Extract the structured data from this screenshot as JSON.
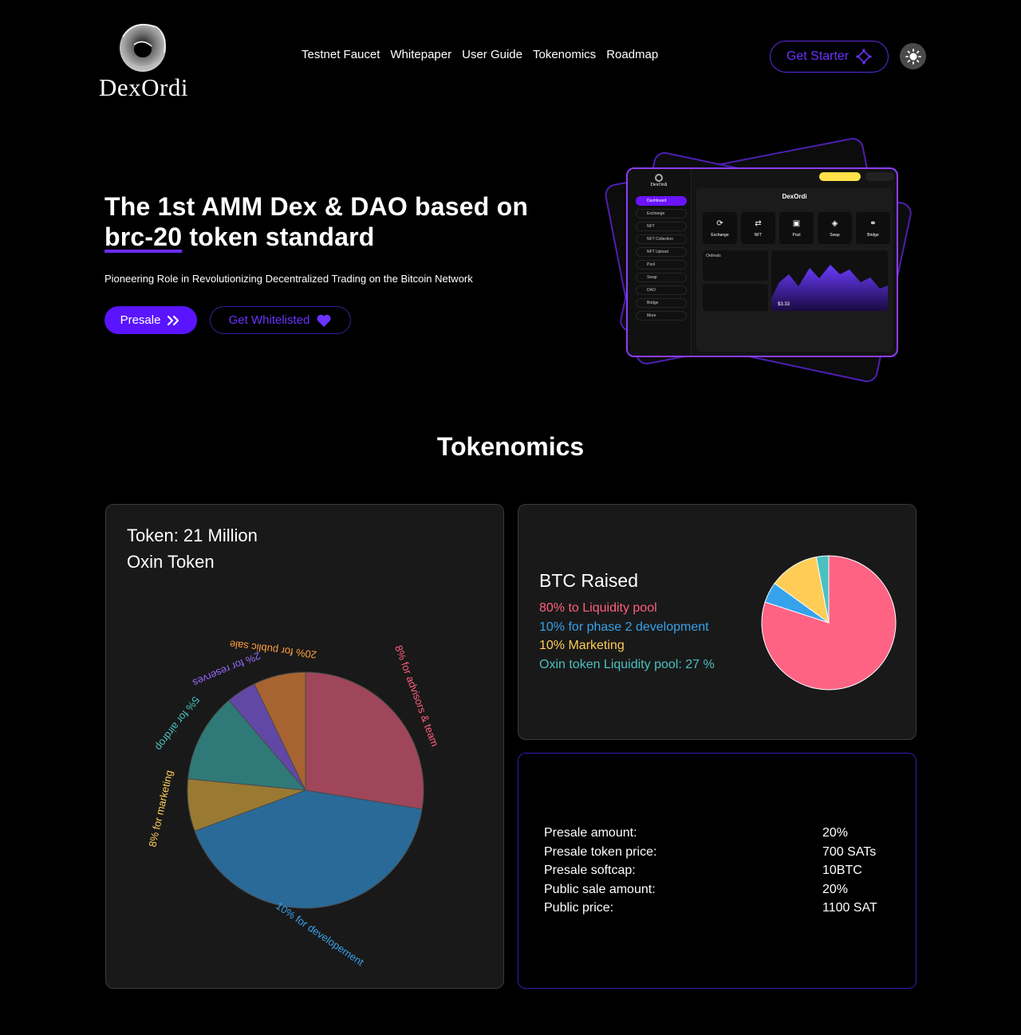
{
  "brand": {
    "name": "DexOrdi"
  },
  "nav": {
    "items": [
      "Testnet Faucet",
      "Whitepaper",
      "User Guide",
      "Tokenomics",
      "Roadmap"
    ],
    "starter_label": "Get Starter"
  },
  "hero": {
    "title_line1": "The 1st AMM Dex & DAO based on",
    "title_highlight": "brc-20",
    "title_rest": " token standard",
    "subtitle": "Pioneering Role in Revolutionizing Decentralized Trading on the Bitcoin Network",
    "presale_label": "Presale",
    "whitelist_label": "Get Whitelisted"
  },
  "mockup": {
    "brand": "DexOrdi",
    "menu": [
      "Dashboard",
      "Exchange",
      "NFT",
      "NFT Collection",
      "NFT Upload",
      "Pool",
      "Swap",
      "DAO",
      "Bridge",
      "More"
    ],
    "title": "DexOrdi",
    "tiles": [
      "Exchange",
      "NFT",
      "Pool",
      "Swap",
      "Bridge"
    ],
    "card_title": "Ordinals",
    "price": "$3.33"
  },
  "tokenomics": {
    "title": "Tokenomics",
    "token_card": {
      "line1": "Token: 21 Million",
      "line2": "Oxin Token"
    },
    "btc_card": {
      "title": "BTC Raised",
      "lines": [
        {
          "text": "80% to Liquidity pool",
          "color": "#ff5f7e"
        },
        {
          "text": "10% for phase 2 development",
          "color": "#36a2eb"
        },
        {
          "text": "10% Marketing",
          "color": "#ffcd56"
        },
        {
          "text": "Oxin token Liquidity pool: 27 %",
          "color": "#4bc0c0"
        }
      ]
    },
    "presale_card": {
      "rows": [
        {
          "label": "Presale amount:",
          "value": "20%"
        },
        {
          "label": "Presale token price:",
          "value": "700 SATs"
        },
        {
          "label": "Presale softcap:",
          "value": "10BTC"
        },
        {
          "label": "Public sale amount:",
          "value": "20%"
        },
        {
          "label": "Public price:",
          "value": "1100 SAT"
        }
      ]
    }
  },
  "chart_data": [
    {
      "type": "pie",
      "title": "",
      "categories": [
        "8% for advisors & team",
        "10% for developement",
        "8% for marketing",
        "5% for airdrop",
        "2% for reserves",
        "20% for public sale"
      ],
      "values": [
        27,
        41,
        7,
        12,
        4,
        7
      ],
      "colors": [
        "#a0465a",
        "#2a6a98",
        "#9a7a32",
        "#2f7a78",
        "#6248a6",
        "#a86430"
      ],
      "label_colors": [
        "#ff5f7e",
        "#36a2eb",
        "#ffcd56",
        "#4bc0c0",
        "#9966ff",
        "#ff9f40"
      ]
    },
    {
      "type": "pie",
      "title": "BTC Raised",
      "categories": [
        "80% to Liquidity pool",
        "10% for phase 2 development",
        "10% Marketing",
        "Oxin token Liquidity pool: 27 %"
      ],
      "values": [
        80,
        5,
        12,
        3
      ],
      "colors": [
        "#ff6384",
        "#36a2eb",
        "#ffcd56",
        "#4bc0c0"
      ]
    }
  ]
}
